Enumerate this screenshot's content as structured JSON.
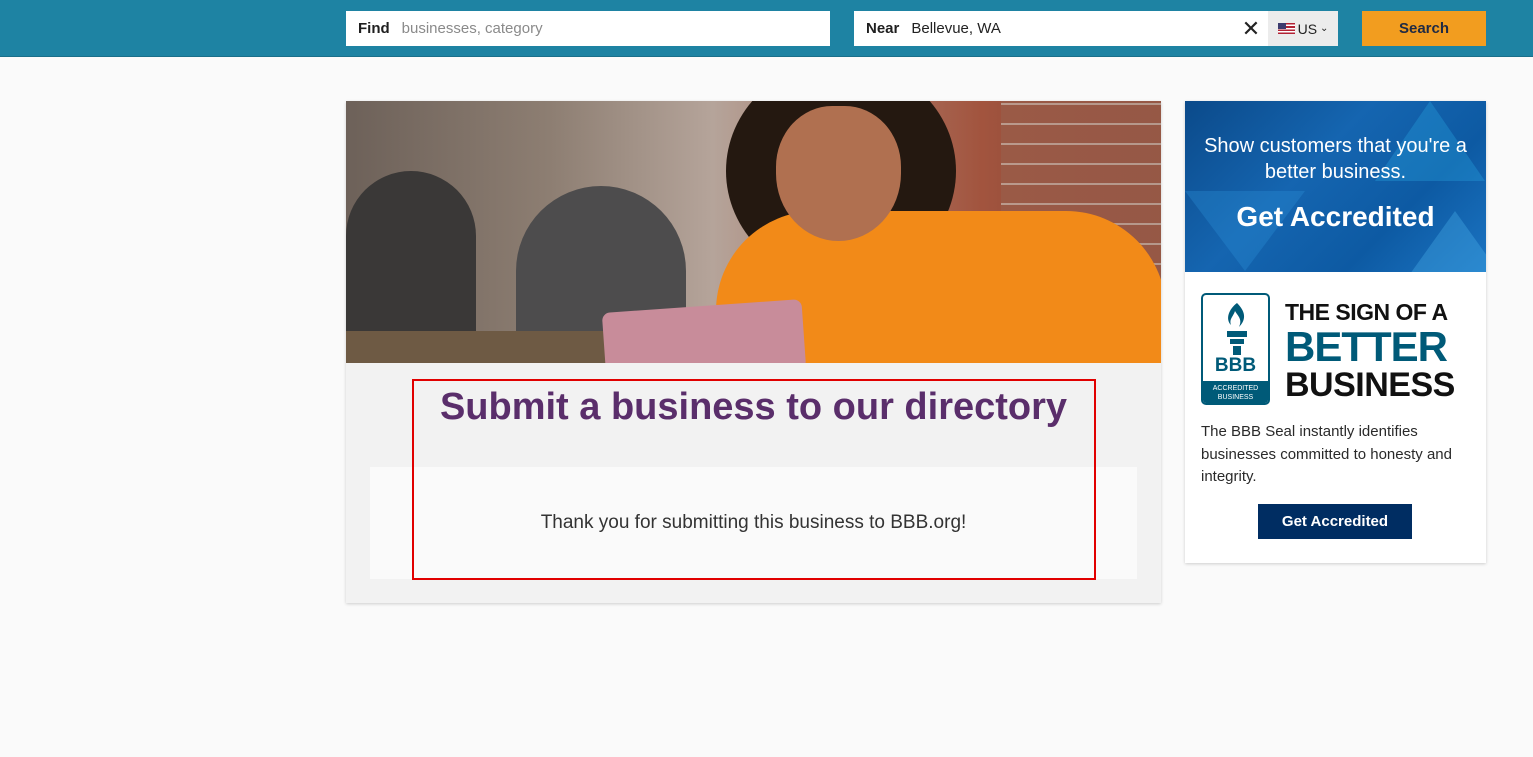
{
  "header": {
    "find_label": "Find",
    "find_placeholder": "businesses, category",
    "near_label": "Near",
    "near_value": "Bellevue, WA",
    "clear_icon": "close-icon",
    "country_code": "US",
    "search_label": "Search"
  },
  "main": {
    "title": "Submit a business to our directory",
    "message": "Thank you for submitting this business to BBB.org!"
  },
  "sidebar": {
    "banner_text": "Show customers that you're a better business.",
    "banner_cta": "Get Accredited",
    "seal_bbb": "BBB",
    "seal_accredited": "ACCREDITED BUSINESS",
    "sign_line1": "THE SIGN OF A",
    "sign_line2": "BETTER",
    "sign_line3": "BUSINESS",
    "description": "The BBB Seal instantly identifies businesses committed to honesty and integrity.",
    "button_label": "Get Accredited"
  },
  "colors": {
    "header_bg": "#1e83a3",
    "search_button": "#f29d1f",
    "title": "#5a2e6b",
    "accredit_button": "#002d62",
    "highlight_border": "#e10000"
  }
}
